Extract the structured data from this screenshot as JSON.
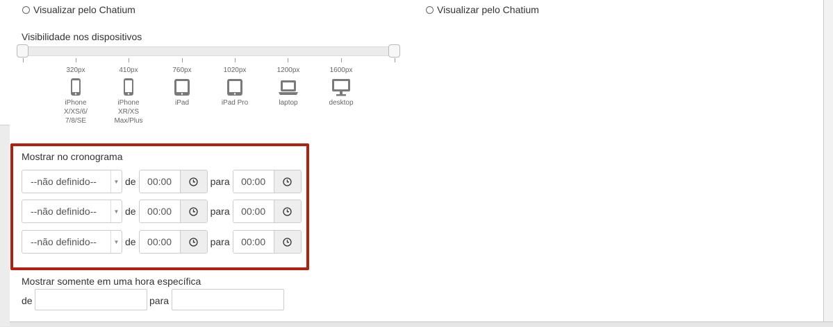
{
  "visibility_options": {
    "left_radio_label": "Visualizar pelo Chatium",
    "right_radio_label": "Visualizar pelo Chatium"
  },
  "devices": {
    "title": "Visibilidade nos dispositivos",
    "slider_range_fraction": [
      0,
      1
    ],
    "breakpoints": [
      {
        "size": "320px",
        "name_lines": [
          "iPhone",
          "X/XS/6/",
          "7/8/SE"
        ],
        "icon": "phone-icon"
      },
      {
        "size": "410px",
        "name_lines": [
          "iPhone",
          "XR/XS",
          "Max/Plus"
        ],
        "icon": "phone-icon"
      },
      {
        "size": "760px",
        "name_lines": [
          "iPad"
        ],
        "icon": "tablet-icon"
      },
      {
        "size": "1020px",
        "name_lines": [
          "iPad Pro"
        ],
        "icon": "tablet-icon"
      },
      {
        "size": "1200px",
        "name_lines": [
          "laptop"
        ],
        "icon": "laptop-icon"
      },
      {
        "size": "1600px",
        "name_lines": [
          "desktop"
        ],
        "icon": "desktop-icon"
      }
    ]
  },
  "schedule": {
    "title": "Mostrar no cronograma",
    "from_word": "de",
    "to_word": "para",
    "rows": [
      {
        "day": "--não definido--",
        "from": "00:00",
        "to": "00:00"
      },
      {
        "day": "--não definido--",
        "from": "00:00",
        "to": "00:00"
      },
      {
        "day": "--não definido--",
        "from": "00:00",
        "to": "00:00"
      }
    ],
    "highlight_color": "#b3200e"
  },
  "specific_hour": {
    "title": "Mostrar somente em uma hora específica",
    "from_word": "de",
    "to_word": "para",
    "from_value": "",
    "to_value": ""
  }
}
